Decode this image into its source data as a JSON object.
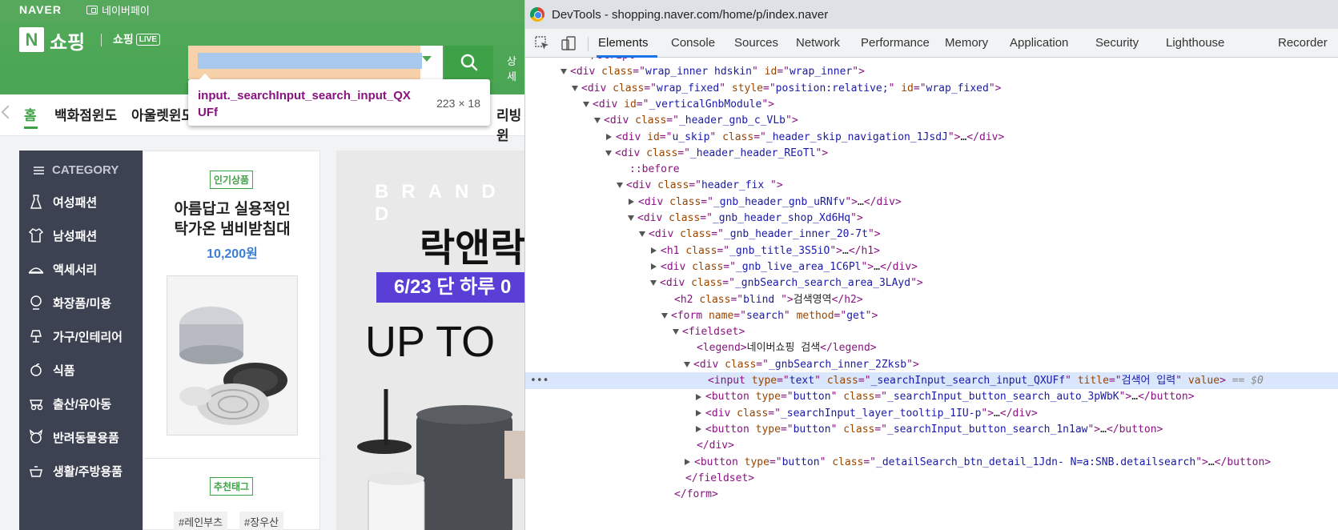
{
  "page": {
    "naver_logo": "NAVER",
    "naverpay": "네이버페이",
    "shopping_logo": "쇼핑",
    "shopping_live": "쇼핑",
    "live_badge": "LIVE",
    "search_value": "",
    "header_detail": "상세",
    "tooltip": {
      "element": "input._searchInput_search_input_QXUFf",
      "size": "223 × 18"
    },
    "catnav": {
      "home": "홈",
      "item1": "백화점윈도",
      "item2": "아울렛윈도",
      "item3": "리빙윈"
    },
    "sidebar": {
      "header": "CATEGORY",
      "items": [
        {
          "label": "여성패션",
          "icon": "dress-icon"
        },
        {
          "label": "남성패션",
          "icon": "shirt-icon"
        },
        {
          "label": "액세서리",
          "icon": "hat-icon"
        },
        {
          "label": "화장품/미용",
          "icon": "mirror-icon"
        },
        {
          "label": "가구/인테리어",
          "icon": "lamp-icon"
        },
        {
          "label": "식품",
          "icon": "food-icon"
        },
        {
          "label": "출산/유아동",
          "icon": "baby-icon"
        },
        {
          "label": "반려동물용품",
          "icon": "pet-icon"
        },
        {
          "label": "생활/주방용품",
          "icon": "kitchen-icon"
        }
      ]
    },
    "promo": {
      "badge": "인기상품",
      "title_line1": "아름답고 실용적인",
      "title_line2": "탁가온 냄비받침대",
      "price": "10,200원",
      "tag_badge": "추천태그",
      "tags": [
        "#레인부츠",
        "#장우산"
      ]
    },
    "banner": {
      "brand": "BRAND D",
      "main": "락앤락",
      "datebar": "6/23 단 하루 0",
      "upto": "UP TO"
    }
  },
  "devtools": {
    "title": "DevTools - shopping.naver.com/home/p/index.naver",
    "tabs": [
      "Elements",
      "Console",
      "Sources",
      "Network",
      "Performance",
      "Memory",
      "Application",
      "Security",
      "Lighthouse",
      "Recorder"
    ],
    "active_tab": "Elements",
    "lines": [
      {
        "indent": 4,
        "tri": "none",
        "html": [
          [
            "tag",
            "<"
          ],
          [
            "tag",
            "/"
          ],
          [
            "tag",
            "script"
          ],
          [
            "tag",
            ">"
          ]
        ],
        "partial": true
      },
      {
        "indent": 3,
        "tri": "open",
        "html": [
          [
            "tag",
            "<div "
          ],
          [
            "attr",
            "class"
          ],
          [
            "tag",
            "=\""
          ],
          [
            "val",
            "wrap_inner hdskin"
          ],
          [
            "tag",
            "\" "
          ],
          [
            "attr",
            "id"
          ],
          [
            "tag",
            "=\""
          ],
          [
            "val",
            "wrap_inner"
          ],
          [
            "tag",
            "\">"
          ]
        ]
      },
      {
        "indent": 4,
        "tri": "open",
        "html": [
          [
            "tag",
            "<div "
          ],
          [
            "attr",
            "class"
          ],
          [
            "tag",
            "=\""
          ],
          [
            "val",
            "wrap_fixed"
          ],
          [
            "tag",
            "\" "
          ],
          [
            "attr",
            "style"
          ],
          [
            "tag",
            "=\""
          ],
          [
            "val",
            "position:relative;"
          ],
          [
            "tag",
            "\" "
          ],
          [
            "attr",
            "id"
          ],
          [
            "tag",
            "=\""
          ],
          [
            "val",
            "wrap_fixed"
          ],
          [
            "tag",
            "\">"
          ]
        ]
      },
      {
        "indent": 5,
        "tri": "open",
        "html": [
          [
            "tag",
            "<div "
          ],
          [
            "attr",
            "id"
          ],
          [
            "tag",
            "=\""
          ],
          [
            "val",
            "_verticalGnbModule"
          ],
          [
            "tag",
            "\">"
          ]
        ]
      },
      {
        "indent": 6,
        "tri": "open",
        "html": [
          [
            "tag",
            "<div "
          ],
          [
            "attr",
            "class"
          ],
          [
            "tag",
            "=\""
          ],
          [
            "val",
            "_header_gnb_c_VLb"
          ],
          [
            "tag",
            "\">"
          ]
        ]
      },
      {
        "indent": 7,
        "tri": "closed",
        "html": [
          [
            "tag",
            "<div "
          ],
          [
            "attr",
            "id"
          ],
          [
            "tag",
            "=\""
          ],
          [
            "val",
            "u_skip"
          ],
          [
            "tag",
            "\" "
          ],
          [
            "attr",
            "class"
          ],
          [
            "tag",
            "=\""
          ],
          [
            "val",
            "_header_skip_navigation_1JsdJ"
          ],
          [
            "tag",
            "\">"
          ],
          [
            "text",
            "…"
          ],
          [
            "tag",
            "</div>"
          ]
        ]
      },
      {
        "indent": 7,
        "tri": "open",
        "html": [
          [
            "tag",
            "<div "
          ],
          [
            "attr",
            "class"
          ],
          [
            "tag",
            "=\""
          ],
          [
            "val",
            "_header_header_REoTl"
          ],
          [
            "tag",
            "\">"
          ]
        ]
      },
      {
        "indent": 8,
        "tri": "none",
        "html": [
          [
            "pseudo",
            "::before"
          ]
        ]
      },
      {
        "indent": 8,
        "tri": "open",
        "html": [
          [
            "tag",
            "<div "
          ],
          [
            "attr",
            "class"
          ],
          [
            "tag",
            "=\""
          ],
          [
            "val",
            "header_fix "
          ],
          [
            "tag",
            "\">"
          ]
        ]
      },
      {
        "indent": 9,
        "tri": "closed",
        "html": [
          [
            "tag",
            "<div "
          ],
          [
            "attr",
            "class"
          ],
          [
            "tag",
            "=\""
          ],
          [
            "val",
            "_gnb_header_gnb_uRNfv"
          ],
          [
            "tag",
            "\">"
          ],
          [
            "text",
            "…"
          ],
          [
            "tag",
            "</div>"
          ]
        ]
      },
      {
        "indent": 9,
        "tri": "open",
        "html": [
          [
            "tag",
            "<div "
          ],
          [
            "attr",
            "class"
          ],
          [
            "tag",
            "=\""
          ],
          [
            "val",
            "_gnb_header_shop_Xd6Hq"
          ],
          [
            "tag",
            "\">"
          ]
        ]
      },
      {
        "indent": 10,
        "tri": "open",
        "html": [
          [
            "tag",
            "<div "
          ],
          [
            "attr",
            "class"
          ],
          [
            "tag",
            "=\""
          ],
          [
            "val",
            "_gnb_header_inner_20-7t"
          ],
          [
            "tag",
            "\">"
          ]
        ]
      },
      {
        "indent": 11,
        "tri": "closed",
        "html": [
          [
            "tag",
            "<h1 "
          ],
          [
            "attr",
            "class"
          ],
          [
            "tag",
            "=\""
          ],
          [
            "val",
            "_gnb_title_3S5iO"
          ],
          [
            "tag",
            "\">"
          ],
          [
            "text",
            "…"
          ],
          [
            "tag",
            "</h1>"
          ]
        ]
      },
      {
        "indent": 11,
        "tri": "closed",
        "html": [
          [
            "tag",
            "<div "
          ],
          [
            "attr",
            "class"
          ],
          [
            "tag",
            "=\""
          ],
          [
            "val",
            "_gnb_live_area_1C6Pl"
          ],
          [
            "tag",
            "\">"
          ],
          [
            "text",
            "…"
          ],
          [
            "tag",
            "</div>"
          ]
        ]
      },
      {
        "indent": 11,
        "tri": "open",
        "html": [
          [
            "tag",
            "<div "
          ],
          [
            "attr",
            "class"
          ],
          [
            "tag",
            "=\""
          ],
          [
            "val",
            "_gnbSearch_search_area_3LAyd"
          ],
          [
            "tag",
            "\">"
          ]
        ]
      },
      {
        "indent": 12,
        "tri": "none",
        "html": [
          [
            "tag",
            "<h2 "
          ],
          [
            "attr",
            "class"
          ],
          [
            "tag",
            "=\""
          ],
          [
            "val",
            "blind "
          ],
          [
            "tag",
            "\">"
          ],
          [
            "text",
            "검색영역"
          ],
          [
            "tag",
            "</h2>"
          ]
        ]
      },
      {
        "indent": 12,
        "tri": "open",
        "html": [
          [
            "tag",
            "<form "
          ],
          [
            "attr",
            "name"
          ],
          [
            "tag",
            "=\""
          ],
          [
            "val",
            "search"
          ],
          [
            "tag",
            "\" "
          ],
          [
            "attr",
            "method"
          ],
          [
            "tag",
            "=\""
          ],
          [
            "val",
            "get"
          ],
          [
            "tag",
            "\">"
          ]
        ]
      },
      {
        "indent": 13,
        "tri": "open",
        "html": [
          [
            "tag",
            "<fieldset>"
          ]
        ]
      },
      {
        "indent": 14,
        "tri": "none",
        "html": [
          [
            "tag",
            "<legend>"
          ],
          [
            "text",
            "네이버쇼핑 검색"
          ],
          [
            "tag",
            "</legend>"
          ]
        ]
      },
      {
        "indent": 14,
        "tri": "open",
        "html": [
          [
            "tag",
            "<div "
          ],
          [
            "attr",
            "class"
          ],
          [
            "tag",
            "=\""
          ],
          [
            "val",
            "_gnbSearch_inner_2Zksb"
          ],
          [
            "tag",
            "\">"
          ]
        ]
      },
      {
        "indent": 15,
        "tri": "none",
        "selected": true,
        "html": [
          [
            "tag",
            "<input "
          ],
          [
            "attr",
            "type"
          ],
          [
            "tag",
            "=\""
          ],
          [
            "val",
            "text"
          ],
          [
            "tag",
            "\" "
          ],
          [
            "attr",
            "class"
          ],
          [
            "tag",
            "=\""
          ],
          [
            "val",
            "_searchInput_search_input_QXUFf"
          ],
          [
            "tag",
            "\" "
          ],
          [
            "attr",
            "title"
          ],
          [
            "tag",
            "=\""
          ],
          [
            "val",
            "검색어 입력"
          ],
          [
            "tag",
            "\" "
          ],
          [
            "attr",
            "value"
          ],
          [
            "tag",
            "> "
          ],
          [
            "eq",
            "== $0"
          ]
        ]
      },
      {
        "indent": 15,
        "tri": "closed",
        "html": [
          [
            "tag",
            "<button "
          ],
          [
            "attr",
            "type"
          ],
          [
            "tag",
            "=\""
          ],
          [
            "val",
            "button"
          ],
          [
            "tag",
            "\" "
          ],
          [
            "attr",
            "class"
          ],
          [
            "tag",
            "=\""
          ],
          [
            "val",
            "_searchInput_button_search_auto_3pWbK"
          ],
          [
            "tag",
            "\">"
          ],
          [
            "text",
            "…"
          ],
          [
            "tag",
            "</button>"
          ]
        ]
      },
      {
        "indent": 15,
        "tri": "closed",
        "html": [
          [
            "tag",
            "<div "
          ],
          [
            "attr",
            "class"
          ],
          [
            "tag",
            "=\""
          ],
          [
            "val",
            "_searchInput_layer_tooltip_1IU-p"
          ],
          [
            "tag",
            "\">"
          ],
          [
            "text",
            "…"
          ],
          [
            "tag",
            "</div>"
          ]
        ]
      },
      {
        "indent": 15,
        "tri": "closed",
        "html": [
          [
            "tag",
            "<button "
          ],
          [
            "attr",
            "type"
          ],
          [
            "tag",
            "=\""
          ],
          [
            "val",
            "button"
          ],
          [
            "tag",
            "\" "
          ],
          [
            "attr",
            "class"
          ],
          [
            "tag",
            "=\""
          ],
          [
            "val",
            "_searchInput_button_search_1n1aw"
          ],
          [
            "tag",
            "\">"
          ],
          [
            "text",
            "…"
          ],
          [
            "tag",
            "</button>"
          ]
        ]
      },
      {
        "indent": 14,
        "tri": "none",
        "html": [
          [
            "tag",
            "</div>"
          ]
        ]
      },
      {
        "indent": 14,
        "tri": "closed",
        "html": [
          [
            "tag",
            "<button "
          ],
          [
            "attr",
            "type"
          ],
          [
            "tag",
            "=\""
          ],
          [
            "val",
            "button"
          ],
          [
            "tag",
            "\" "
          ],
          [
            "attr",
            "class"
          ],
          [
            "tag",
            "=\""
          ],
          [
            "val",
            "_detailSearch_btn_detail_1Jdn- N=a:SNB.detailsearch"
          ],
          [
            "tag",
            "\">"
          ],
          [
            "text",
            "…"
          ],
          [
            "tag",
            "</button>"
          ]
        ]
      },
      {
        "indent": 13,
        "tri": "none",
        "html": [
          [
            "tag",
            "</fieldset>"
          ]
        ]
      },
      {
        "indent": 12,
        "tri": "none",
        "html": [
          [
            "tag",
            "</form>"
          ]
        ]
      }
    ]
  }
}
